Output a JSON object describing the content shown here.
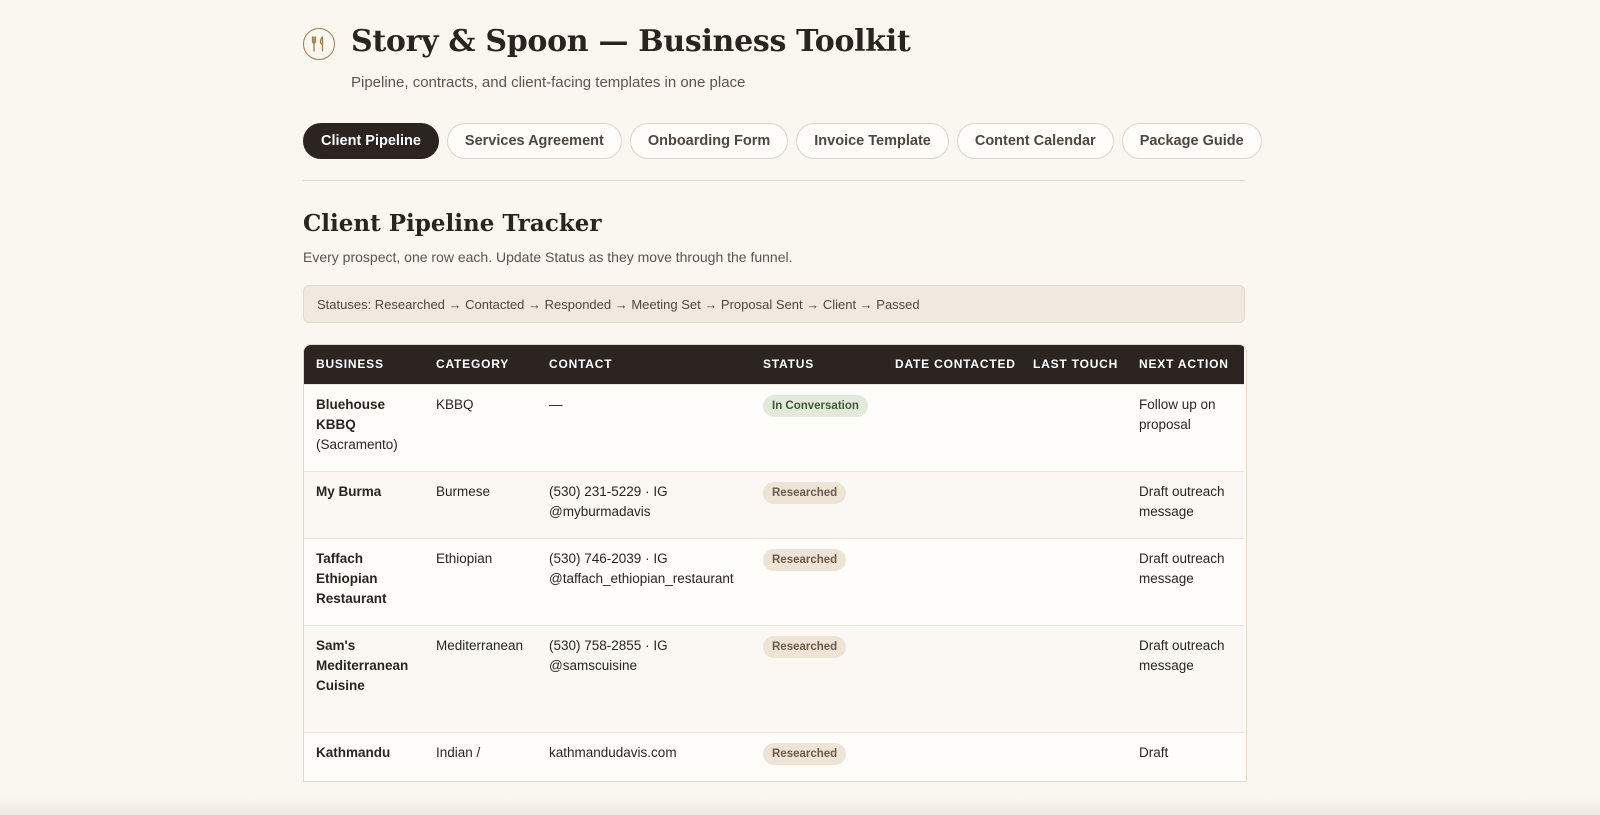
{
  "header": {
    "logo_icon": "fork-spoon-icon",
    "title": "Story & Spoon — Business Toolkit",
    "subtitle": "Pipeline, contracts, and client-facing templates in one place"
  },
  "tabs": [
    {
      "label": "Client Pipeline",
      "active": true
    },
    {
      "label": "Services Agreement",
      "active": false
    },
    {
      "label": "Onboarding Form",
      "active": false
    },
    {
      "label": "Invoice Template",
      "active": false
    },
    {
      "label": "Content Calendar",
      "active": false
    },
    {
      "label": "Package Guide",
      "active": false
    }
  ],
  "section": {
    "title": "Client Pipeline Tracker",
    "description": "Every prospect, one row each. Update Status as they move through the funnel.",
    "statuses_line": "Statuses: Researched → Contacted → Responded → Meeting Set → Proposal Sent → Client → Passed"
  },
  "table": {
    "columns": [
      "Business",
      "Category",
      "Contact",
      "Status",
      "Date Contacted",
      "Last Touch",
      "Next Action"
    ],
    "rows": [
      {
        "name": "Bluehouse KBBQ",
        "location": "(Sacramento)",
        "category": "KBBQ",
        "contact": "—",
        "status": "In Conversation",
        "status_kind": "conv",
        "date_contacted": "",
        "last_touch": "",
        "next_action": "Follow up on proposal"
      },
      {
        "name": "My Burma",
        "location": "",
        "category": "Burmese",
        "contact": "(530) 231-5229 · IG @myburmadavis",
        "status": "Researched",
        "status_kind": "res",
        "date_contacted": "",
        "last_touch": "",
        "next_action": "Draft outreach message"
      },
      {
        "name": "Taffach Ethiopian Restaurant",
        "location": "",
        "category": "Ethiopian",
        "contact": "(530) 746-2039 · IG @taffach_ethiopian_restaurant",
        "status": "Researched",
        "status_kind": "res",
        "date_contacted": "",
        "last_touch": "",
        "next_action": "Draft outreach message"
      },
      {
        "name": "Sam's Mediterranean Cuisine",
        "location": "",
        "category": "Mediterranean",
        "contact": "(530) 758-2855 · IG @samscuisine",
        "status": "Researched",
        "status_kind": "res",
        "date_contacted": "",
        "last_touch": "",
        "next_action": "Draft outreach message"
      },
      {
        "name": "Kathmandu",
        "location": "",
        "category": "Indian /",
        "contact": "kathmandudavis.com",
        "status": "Researched",
        "status_kind": "res",
        "date_contacted": "",
        "last_touch": "",
        "next_action": "Draft"
      }
    ]
  },
  "colors": {
    "background": "#faf6f0",
    "dark": "#2b2420",
    "accent_gold": "#a07d48",
    "badge_conversation": "#e3eadb",
    "badge_researched": "#ede4d6"
  }
}
